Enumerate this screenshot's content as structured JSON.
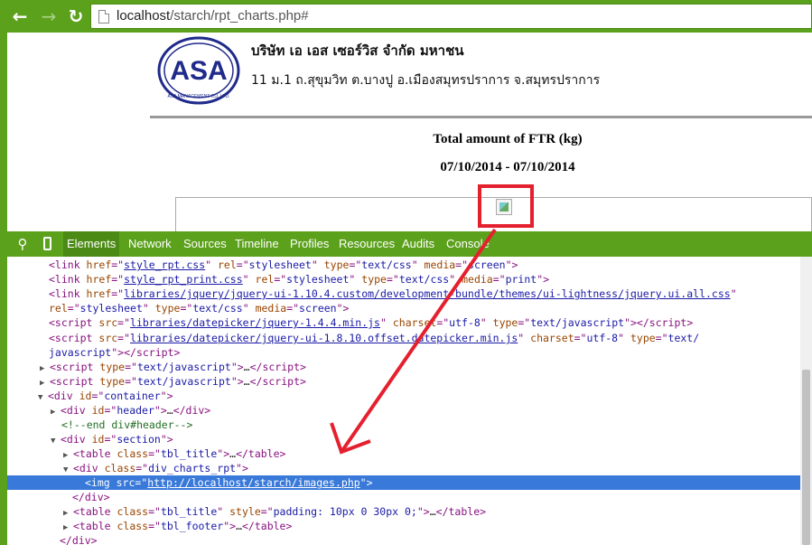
{
  "browser": {
    "url_host": "localhost",
    "url_path": "/starch/rpt_charts.php#",
    "back_icon": "back-arrow-icon",
    "forward_icon": "forward-arrow-icon",
    "reload_icon": "reload-icon"
  },
  "page": {
    "company_name": "บริษัท เอ เอส เซอร์วิส จำกัด มหาชน",
    "company_address": "11 ม.1 ถ.สุขุมวิท ต.บางปู อ.เมืองสมุทรปราการ จ.สมุทรปราการ",
    "logo_text": "ASA",
    "logo_subtext": "ASA MANAGEMENT CO.,LTD.",
    "report_title": "Total amount of FTR (kg)",
    "report_date_range": "07/10/2014 - 07/10/2014"
  },
  "devtools": {
    "tabs": [
      "Elements",
      "Network",
      "Sources",
      "Timeline",
      "Profiles",
      "Resources",
      "Audits",
      "Console"
    ],
    "active_tab": "Elements",
    "source": [
      {
        "link1_href": "style_rpt.css",
        "link1_rel": "stylesheet",
        "link1_type": "text/css",
        "link1_media": "screen"
      },
      {
        "link2_href": "style_rpt_print.css",
        "link2_rel": "stylesheet",
        "link2_type": "text/css",
        "link2_media": "print"
      },
      {
        "link3_href": "libraries/jquery/jquery-ui-1.10.4.custom/development-bundle/themes/ui-lightness/jquery.ui.all.css",
        "link3_rel": "stylesheet",
        "link3_type": "text/css",
        "link3_media": "screen"
      },
      {
        "script1_src": "libraries/datepicker/jquery-1.4.4.min.js",
        "script1_charset": "utf-8",
        "script1_type": "text/javascript"
      },
      {
        "script2_src": "libraries/datepicker/jquery-ui-1.8.10.offset.datepicker.min.js",
        "script2_charset": "utf-8",
        "script2_type_a": "text/",
        "script2_type_b": "javascript"
      }
    ],
    "strings": {
      "text_js": "text/javascript",
      "container": "container",
      "header": "header",
      "comment": "<!--end div#header-->",
      "section": "section",
      "tbl_title": "tbl_title",
      "div_charts_rpt": "div_charts_rpt",
      "img_src": "http://localhost/starch/images.php",
      "style_padding": "padding: 10px 0 30px 0;",
      "tbl_footer": "tbl_footer"
    }
  },
  "colors": {
    "chrome_green": "#5ca11c",
    "selection_blue": "#3879d9",
    "annotation_red": "#e5202e"
  }
}
